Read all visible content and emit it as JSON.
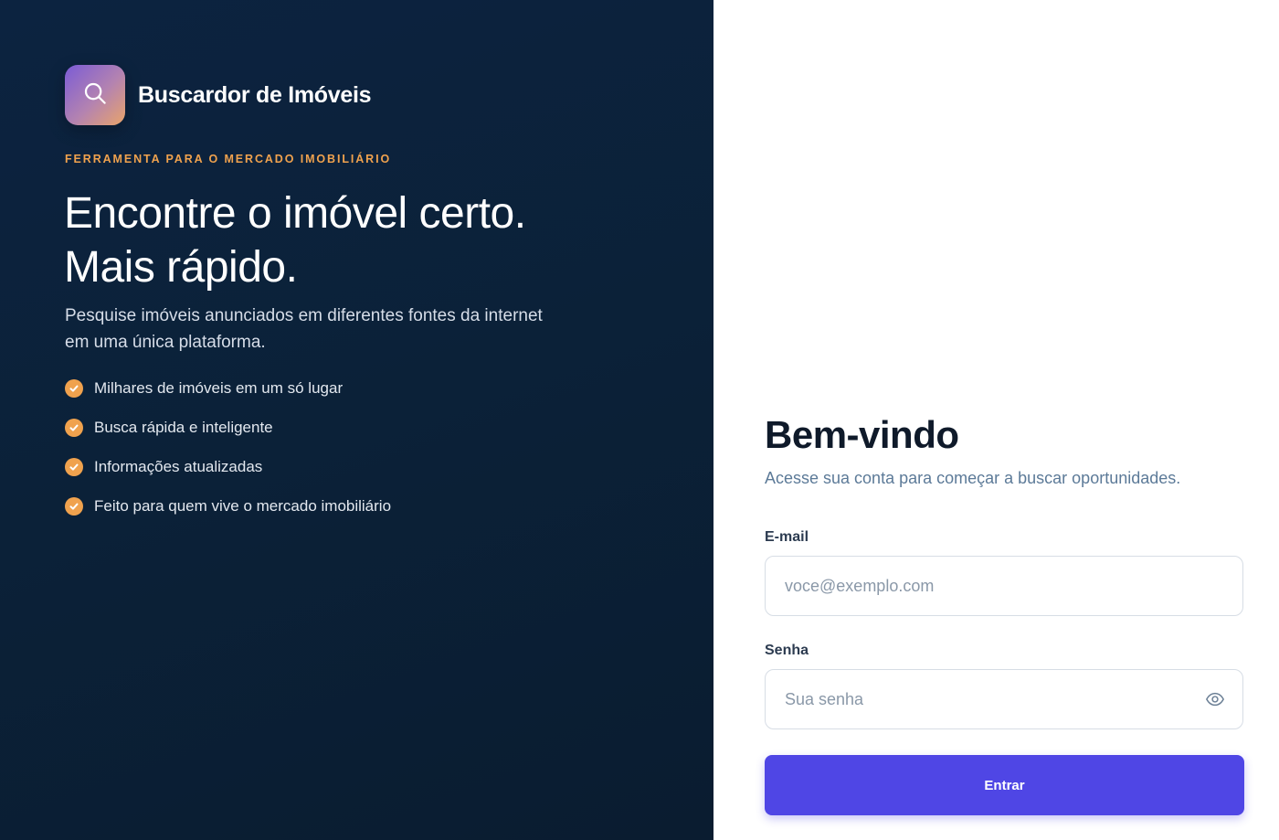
{
  "brand": {
    "name": "Buscardor de Imóveis",
    "logo_icon": "search-icon"
  },
  "hero": {
    "eyebrow": "FERRAMENTA PARA O MERCADO IMOBILIÁRIO",
    "headline_line1": "Encontre o imóvel certo.",
    "headline_line2": "Mais rápido.",
    "subtitle": "Pesquise imóveis anunciados em diferentes fontes da internet em uma única plataforma.",
    "features": [
      "Milhares de imóveis em um só lugar",
      "Busca rápida e inteligente",
      "Informações atualizadas",
      "Feito para quem vive o mercado imobiliário"
    ]
  },
  "login": {
    "title": "Bem-vindo",
    "subtitle": "Acesse sua conta para começar a buscar oportunidades.",
    "email_label": "E-mail",
    "email_placeholder": "voce@exemplo.com",
    "email_value": "",
    "password_label": "Senha",
    "password_placeholder": "Sua senha",
    "password_value": "",
    "password_toggle_icon": "eye-icon",
    "submit_label": "Entrar"
  },
  "colors": {
    "left_background": "#0c2340",
    "accent_orange": "#f0a24e",
    "primary_button": "#4f46e5"
  }
}
